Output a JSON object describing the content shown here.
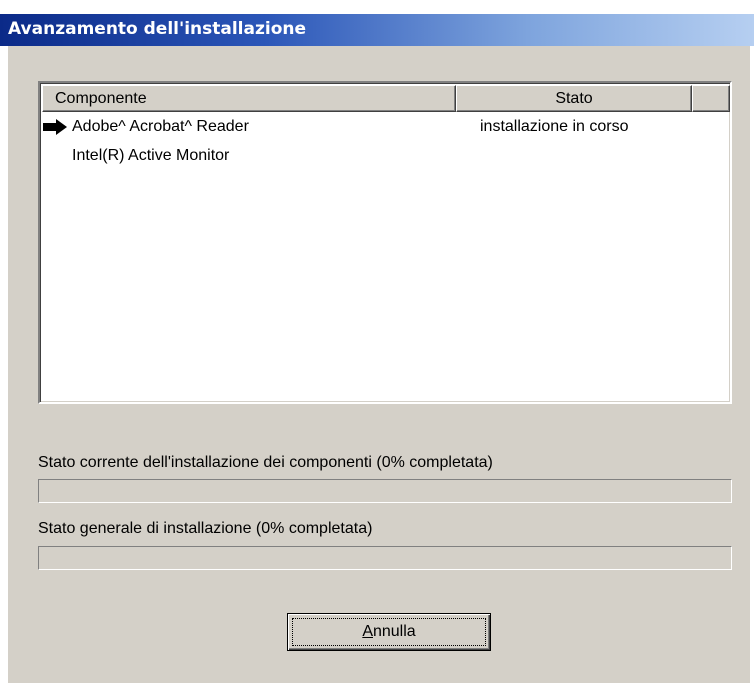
{
  "window": {
    "title": "Avanzamento dell'installazione"
  },
  "list": {
    "columns": {
      "component": "Componente",
      "status": "Stato"
    },
    "rows": [
      {
        "name": "Adobe^ Acrobat^ Reader",
        "status": "installazione in corso",
        "current": true,
        "icon": "right-arrow-icon"
      },
      {
        "name": "Intel(R) Active Monitor",
        "status": "",
        "current": false
      }
    ]
  },
  "progress": {
    "current_label": "Stato corrente dell'installazione dei componenti (0% completata)",
    "current_fraction": 0,
    "overall_label": "Stato generale di installazione  (0% completata)",
    "overall_fraction": 0
  },
  "buttons": {
    "cancel_accel": "A",
    "cancel_rest": "nnulla"
  }
}
